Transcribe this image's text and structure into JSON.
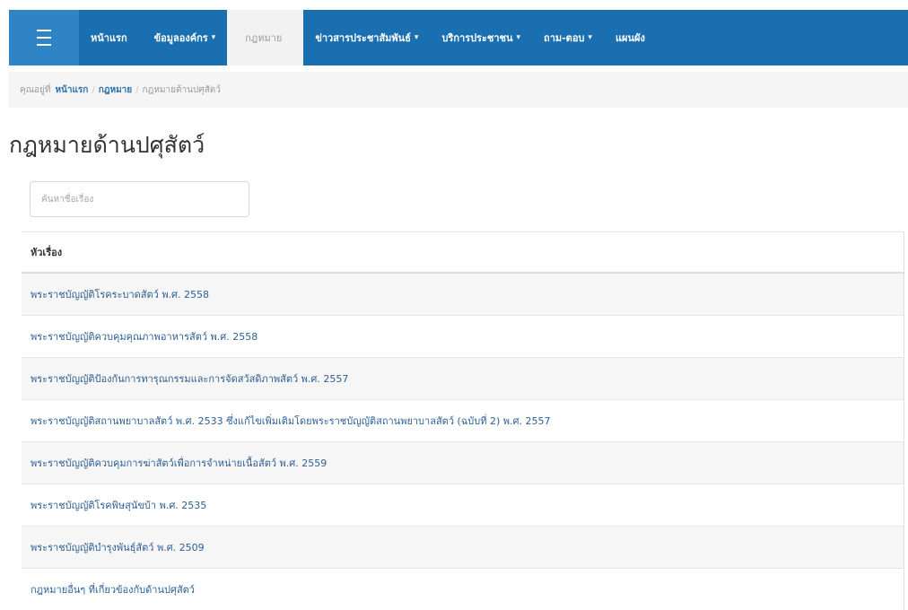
{
  "nav": {
    "items": [
      {
        "label": "หน้าแรก",
        "caret": ""
      },
      {
        "label": "ข้อมูลองค์กร",
        "caret": "▾"
      },
      {
        "label": "กฎหมาย",
        "caret": ""
      },
      {
        "label": "ข่าวสารประชาสัมพันธ์",
        "caret": "▾"
      },
      {
        "label": "บริการประชาชน",
        "caret": "▾"
      },
      {
        "label": "ถาม-ตอบ",
        "caret": "▾"
      },
      {
        "label": "แผนผัง",
        "caret": ""
      }
    ]
  },
  "breadcrumb": {
    "prefix": "คุณอยู่ที่",
    "home": "หน้าแรก",
    "section": "กฎหมาย",
    "current": "กฎหมายด้านปศุสัตว์",
    "separator": "/"
  },
  "page": {
    "title": "กฎหมายด้านปศุสัตว์"
  },
  "search": {
    "placeholder": "ค้นหาชื่อเรื่อง"
  },
  "table": {
    "header": "หัวเรื่อง",
    "rows": [
      "พระราชบัญญัติโรคระบาดสัตว์ พ.ศ. 2558",
      "พระราชบัญญัติควบคุมคุณภาพอาหารสัตว์ พ.ศ. 2558",
      "พระราชบัญญัติป้องกันการทารุณกรรมและการจัดสวัสดิภาพสัตว์ พ.ศ. 2557",
      "พระราชบัญญัติสถานพยาบาลสัตว์ พ.ศ. 2533 ซึ่งแก้ไขเพิ่มเติมโดยพระราชบัญญัติสถานพยาบาลสัตว์ (ฉบับที่ 2) พ.ศ. 2557",
      "พระราชบัญญัติควบคุมการฆ่าสัตว์เพื่อการจำหน่ายเนื้อสัตว์ พ.ศ. 2559",
      "พระราชบัญญัติโรคพิษสุนัขบ้า พ.ศ. 2535",
      "พระราชบัญญัติบำรุงพันธุ์สัตว์ พ.ศ. 2509",
      "กฎหมายอื่นๆ ที่เกี่ยวข้องกับด้านปศุสัตว์"
    ]
  },
  "colors": {
    "navbar": "#1a6fb0",
    "active_tab": "#f2f2f2",
    "link": "#2d5f92"
  }
}
